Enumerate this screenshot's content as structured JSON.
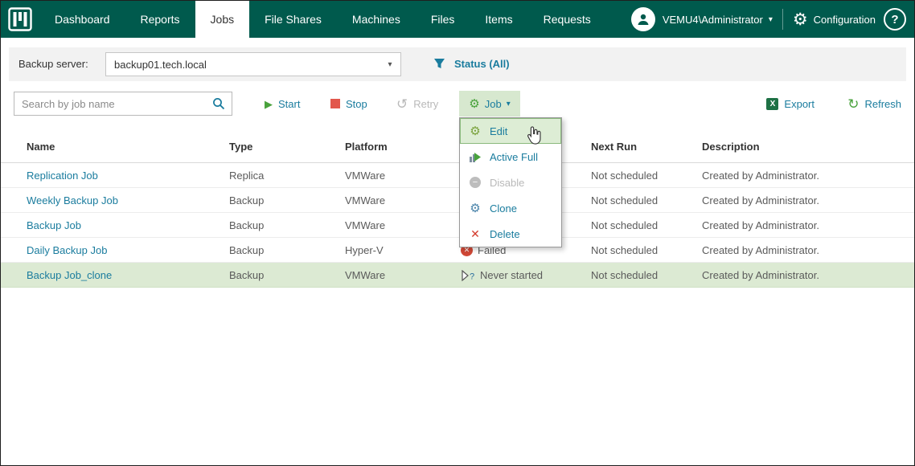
{
  "nav": {
    "items": [
      "Dashboard",
      "Reports",
      "Jobs",
      "File Shares",
      "Machines",
      "Files",
      "Items",
      "Requests"
    ],
    "active_item": "Jobs",
    "user_name": "VEMU4\\Administrator",
    "config_label": "Configuration"
  },
  "filter_bar": {
    "server_label": "Backup server:",
    "server_value": "backup01.tech.local",
    "status_label": "Status (All)"
  },
  "toolbar": {
    "search_placeholder": "Search by job name",
    "start_label": "Start",
    "stop_label": "Stop",
    "retry_label": "Retry",
    "job_label": "Job",
    "export_label": "Export",
    "refresh_label": "Refresh"
  },
  "job_menu": {
    "items": [
      {
        "label": "Edit",
        "icon": "edit-gear",
        "state": "highlighted"
      },
      {
        "label": "Active Full",
        "icon": "active-full",
        "state": "normal"
      },
      {
        "label": "Disable",
        "icon": "disable-circle",
        "state": "disabled"
      },
      {
        "label": "Clone",
        "icon": "clone-gear",
        "state": "normal"
      },
      {
        "label": "Delete",
        "icon": "delete-x",
        "state": "normal"
      }
    ]
  },
  "table": {
    "headers": [
      "Name",
      "Type",
      "Platform",
      "Next Run",
      "Description"
    ],
    "rows": [
      {
        "name": "Replication Job",
        "type": "Replica",
        "platform": "VMWare",
        "status": "",
        "next_run": "Not scheduled",
        "description": "Created by Administrator.",
        "selected": false
      },
      {
        "name": "Weekly Backup Job",
        "type": "Backup",
        "platform": "VMWare",
        "status": "",
        "next_run": "Not scheduled",
        "description": "Created by Administrator.",
        "selected": false
      },
      {
        "name": "Backup Job",
        "type": "Backup",
        "platform": "VMWare",
        "status": "",
        "next_run": "Not scheduled",
        "description": "Created by Administrator.",
        "selected": false
      },
      {
        "name": "Daily Backup Job",
        "type": "Backup",
        "platform": "Hyper-V",
        "status": "Failed",
        "next_run": "Not scheduled",
        "description": "Created by Administrator.",
        "selected": false
      },
      {
        "name": "Backup Job_clone",
        "type": "Backup",
        "platform": "VMWare",
        "status": "Never started",
        "next_run": "Not scheduled",
        "description": "Created by Administrator.",
        "selected": true
      }
    ]
  },
  "icons": {
    "gear": "⚙",
    "chevron_down": "▾",
    "start": "▶",
    "retry": "↺",
    "refresh": "↻",
    "help": "?",
    "excel_x": "X",
    "delete": "✕",
    "failed_x": "✕",
    "disable_minus": "−",
    "question": "?"
  },
  "colors": {
    "header_green": "#005A4D",
    "accent_teal": "#1A7C9E",
    "accent_green": "#49A23C",
    "stop_red": "#E2574C",
    "failed_red": "#D14836",
    "selected_row_bg": "#DCEAD3",
    "job_button_bg": "#D7E8CF",
    "menu_highlight_bg": "#DDEDD5",
    "filter_bar_bg": "#F2F2F2"
  }
}
